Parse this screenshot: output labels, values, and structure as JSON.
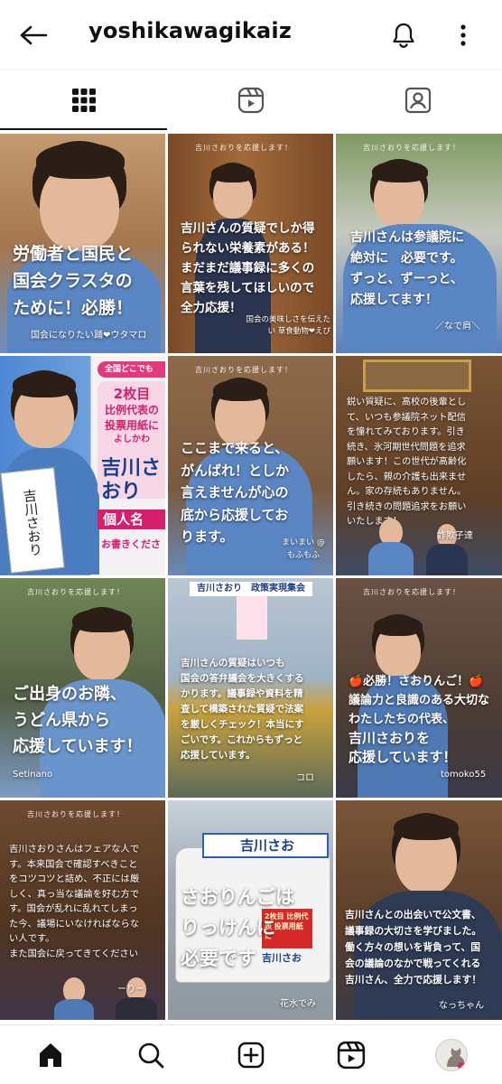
{
  "header": {
    "title": "yoshikawagikaiz"
  },
  "tabs": [
    {
      "name": "grid",
      "icon": "grid-icon"
    },
    {
      "name": "reels",
      "icon": "reels-icon"
    },
    {
      "name": "tagged",
      "icon": "tagged-icon"
    }
  ],
  "posts": [
    {
      "lines": [
        "労働者と国民と",
        "国会クラスタの",
        "ために！必勝！"
      ],
      "sig": "国会になりたい踊❤ウタマロ",
      "bg": "#b98a63"
    },
    {
      "lines": [
        "吉川さんの質疑でしか得",
        "られない栄養素がある！",
        "まだまだ議事録に多くの",
        "言葉を残してほしいので",
        "全力応援！"
      ],
      "sig": "国会の美味しさを伝えたい 草食動物❤えぴ",
      "bg": "#8b5b35"
    },
    {
      "lines": [
        "吉川さんは参議院に",
        "絶対に　必要です。",
        "ずっと、ずーっと、",
        "応援してます！"
      ],
      "sig": "／なで肩＼",
      "bg": "#6f8a55"
    },
    {
      "poster_badge": "全国どこでも",
      "poster_lines": [
        "2枚目",
        "比例代表の",
        "投票用紙に",
        "よしかわ"
      ],
      "poster_name": "吉川さおり",
      "poster_label": "個人名",
      "poster_footer": "お書きくださ",
      "ballot_name": "吉川さおり",
      "bg": "#5b8fd0"
    },
    {
      "lines": [
        "ここまで来ると、",
        "がんばれ！としか",
        "言えませんが心の",
        "底から応援してお",
        "ります。"
      ],
      "sig": "まいまい @もふもふ",
      "bg": "#8a6a4a"
    },
    {
      "lines": [
        "鋭い質疑に、高校の後輩とし",
        "て、いつも参議院ネット配信",
        "を憧れてみております。引き",
        "続き、氷河期世代問題を追求",
        "願います！この世代が高齢化",
        "したら、親の介護も出来ませ",
        "ん。家の存続もありません。",
        "引き続きの問題追求をお願い",
        "いたします！"
      ],
      "sig": "詐欺子達",
      "bg": "#6b4a2e"
    },
    {
      "lines": [
        "ご出身のお隣、",
        "うどん県から",
        "応援しています！"
      ],
      "sig": "Setinano",
      "bg": "#5d6e4a"
    },
    {
      "banner": "吉川さおり　政策実現集会",
      "lines": [
        "吉川さんの質疑はいつも",
        "国会の答弁議会を大きくする",
        "かります。議事録や資料を精",
        "査して構築された質疑で法案",
        "を厳しくチェック！本当にす",
        "ごいです。これからもずっと",
        "応援しています。"
      ],
      "sig": "コロ",
      "bg": "#b9c4d0"
    },
    {
      "lines": [
        "🍎必勝！さおりんご！🍎",
        "議論力と良識のある大切な",
        "わたしたちの代表、",
        "吉川さおりを",
        "応援しています！"
      ],
      "sig": "tomoko55",
      "bg": "#5e4a3e"
    },
    {
      "lines": [
        "吉川さおりさんはフェアな人で",
        "す。本来国会で確認すべきこと",
        "をコツコツと詰め、不正には厳",
        "しく、真っ当な議論を好む方で",
        "す。国会が乱れに乱れてしまっ",
        "た今、議場にいなければならな",
        "い人です。",
        "また国会に戻ってきてください"
      ],
      "sig": "ーりー",
      "bg": "#5a3e2a"
    },
    {
      "lines": [
        "さおりんごは",
        "りっけんに",
        "必要です"
      ],
      "sig": "花水でみ",
      "truck_name": "吉川さお",
      "truck_sub": "2枚目 比例代表 投票用紙に",
      "truck_name2": "吉川さお",
      "bg": "#9aa3ad"
    },
    {
      "lines": [
        "吉川さんとの出会いで公文書、",
        "議事録の大切さを学びました。",
        "働く方々の想いを背負って、国",
        "会の議論のなかで戦ってくれる",
        "吉川さん、全力で応援します！"
      ],
      "sig": "なっちゃん",
      "bg": "#6a4a33"
    }
  ],
  "tile_tag": "吉川さおりを応援します！",
  "bottom_nav": [
    {
      "name": "home",
      "icon": "home-icon"
    },
    {
      "name": "search",
      "icon": "search-icon"
    },
    {
      "name": "create",
      "icon": "plus-square-icon"
    },
    {
      "name": "reels",
      "icon": "reels-icon"
    },
    {
      "name": "profile",
      "icon": "avatar-icon"
    }
  ]
}
